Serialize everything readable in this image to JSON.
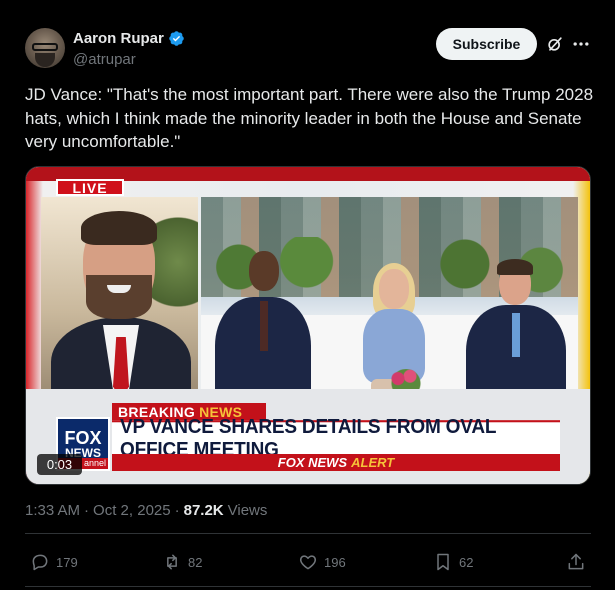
{
  "author": {
    "display_name": "Aaron Rupar",
    "handle": "@atrupar",
    "verified_icon": "verified-badge-icon",
    "verified_color": "#1d9bf0"
  },
  "header": {
    "subscribe_label": "Subscribe",
    "grok_icon": "grok-icon",
    "more_icon": "more-icon"
  },
  "post": {
    "text": "JD Vance: \"That's the most important part. There were also the Trump 2028 hats, which I think made the minority leader in both the House and Senate very uncomfortable.\""
  },
  "video": {
    "live_label": "LIVE",
    "breaking_word": "BREAKING",
    "news_word": "NEWS",
    "headline": "VP VANCE SHARES DETAILS FROM OVAL OFFICE MEETING",
    "alert_brand": "FOX NEWS",
    "alert_word": "ALERT",
    "logo_fox": "FOX",
    "logo_news": "NEWS",
    "logo_channel": "annel",
    "duration": "0:03",
    "accent_red": "#c3111a",
    "accent_gold": "#f6c33a",
    "brand_navy": "#0b2a6a"
  },
  "meta": {
    "time": "1:33 AM",
    "separator": "·",
    "date": "Oct 2, 2025",
    "separator2": "·",
    "views_count": "87.2K",
    "views_label": "Views"
  },
  "actions": {
    "replies": "179",
    "reposts": "82",
    "likes": "196",
    "bookmarks": "62"
  },
  "colors": {
    "background": "#000000",
    "text_primary": "#e7e9ea",
    "text_secondary": "#71767b",
    "border": "#2f3336"
  }
}
